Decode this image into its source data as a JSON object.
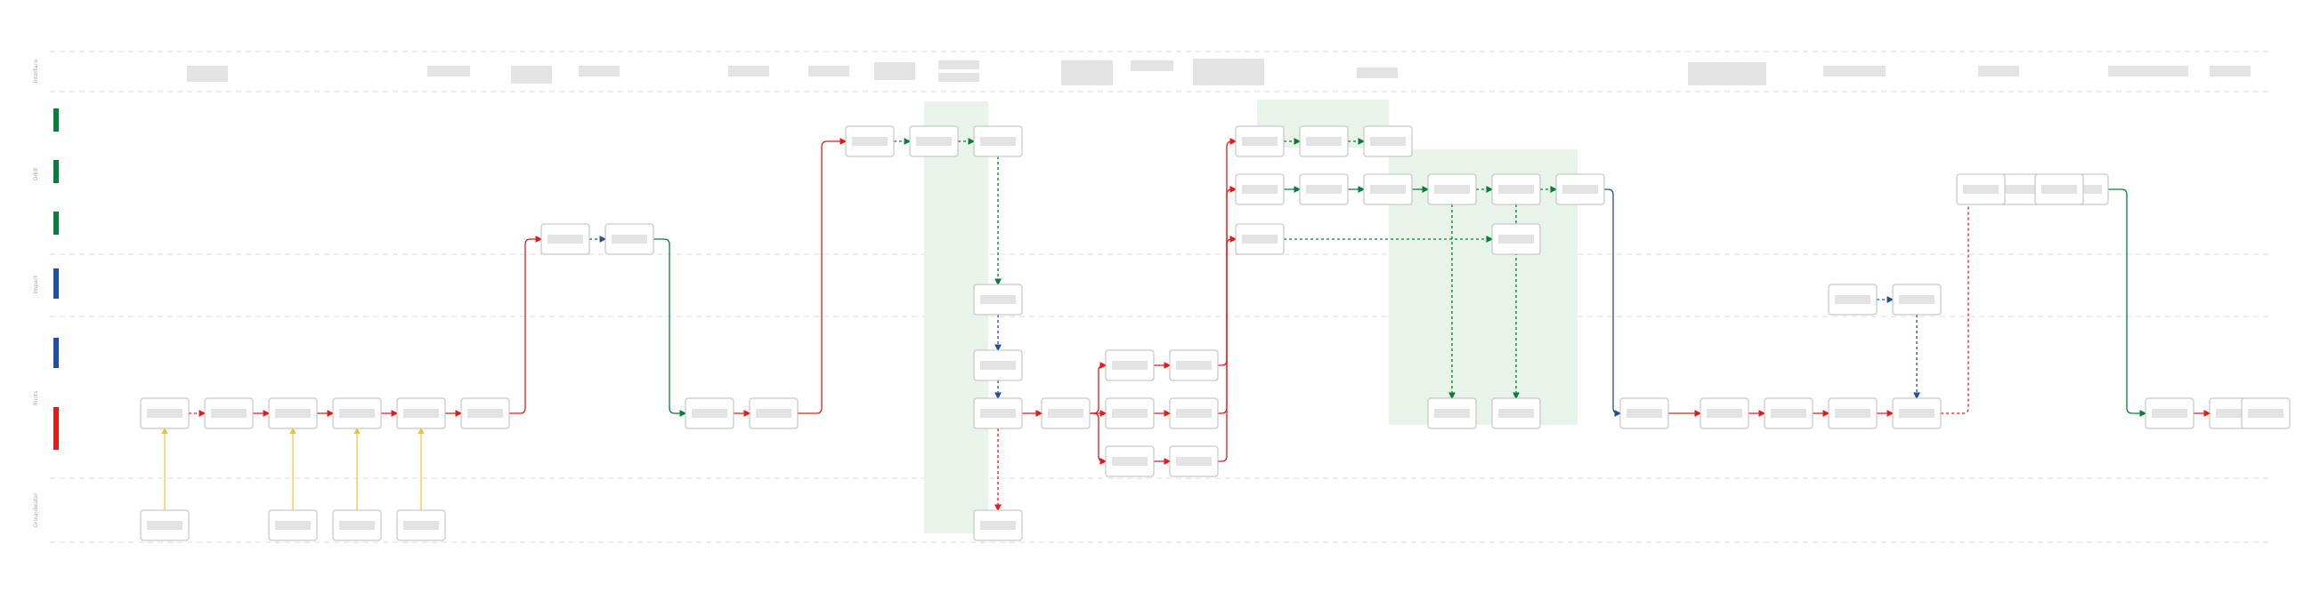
{
  "colors": {
    "green": "#0a7d3a",
    "blue": "#1f4fa3",
    "red": "#e21a1a",
    "yellow": "#f2c12e",
    "box_border": "#bdbdbd",
    "placeholder": "#e3e3e3",
    "group_fill": "#e8f3ea",
    "divider": "#dcdcdc"
  },
  "lanes": [
    {
      "id": "header",
      "label": "Interface"
    },
    {
      "id": "green",
      "label": "Orbit"
    },
    {
      "id": "blue",
      "label": "Impact"
    },
    {
      "id": "red",
      "label": "Roots"
    },
    {
      "id": "bottom",
      "label": "Groundwater"
    }
  ],
  "diagram": {
    "nodes": [
      "n1",
      "n2",
      "n3",
      "n4",
      "n5",
      "n6",
      "n7",
      "n8",
      "n9",
      "n10",
      "n11",
      "n12",
      "n13",
      "n14",
      "n15",
      "n16",
      "n17",
      "n18",
      "n19",
      "n20",
      "n21",
      "n22",
      "n23",
      "n24",
      "n25",
      "n26",
      "n27",
      "n28",
      "n29",
      "n30",
      "n31",
      "n32",
      "n33",
      "n34",
      "n35",
      "n36",
      "n37",
      "n38",
      "n39",
      "n40",
      "n41",
      "n42",
      "n43",
      "n44",
      "n45",
      "n46",
      "n47",
      "n48",
      "n49",
      "n50",
      "n51",
      "n52",
      "n53",
      "n54",
      "n55",
      "n56",
      "n57",
      "n58"
    ],
    "connectors": [
      {
        "from": "n1",
        "to": "n2",
        "color": "red",
        "style": "dashed"
      },
      {
        "from": "n2",
        "to": "n3",
        "color": "red",
        "style": "solid"
      },
      {
        "from": "n3",
        "to": "n4",
        "color": "red",
        "style": "solid"
      },
      {
        "from": "n4",
        "to": "n5",
        "color": "red",
        "style": "solid"
      },
      {
        "from": "n5",
        "to": "n6",
        "color": "red",
        "style": "solid"
      },
      {
        "from": "n6",
        "to": "n7",
        "color": "red",
        "style": "solid"
      },
      {
        "from": "n7",
        "to": "n8",
        "color": "blue",
        "style": "dashed"
      },
      {
        "from": "n8",
        "to": "n9",
        "color": "green",
        "style": "solid"
      },
      {
        "from": "n9",
        "to": "n10",
        "color": "red",
        "style": "solid"
      },
      {
        "from": "n10",
        "to": "n11",
        "color": "red",
        "style": "solid"
      },
      {
        "from": "n11",
        "to": "n12",
        "color": "green",
        "style": "dashed"
      },
      {
        "from": "n12",
        "to": "n13",
        "color": "green",
        "style": "dashed"
      },
      {
        "from": "n13",
        "to": "n14",
        "color": "green",
        "style": "dashed"
      },
      {
        "from": "n14",
        "to": "n15",
        "color": "blue",
        "style": "dashed"
      },
      {
        "from": "n15",
        "to": "n16",
        "color": "blue",
        "style": "dashed"
      },
      {
        "from": "n16",
        "to": "n17",
        "color": "red",
        "style": "dashed"
      },
      {
        "from": "n16",
        "to": "n18",
        "color": "red",
        "style": "solid"
      },
      {
        "from": "n18",
        "to": "n19",
        "color": "red",
        "style": "solid"
      },
      {
        "from": "n18",
        "to": "n20",
        "color": "red",
        "style": "solid"
      },
      {
        "from": "n18",
        "to": "n21",
        "color": "red",
        "style": "solid"
      },
      {
        "from": "n19",
        "to": "n22",
        "color": "red",
        "style": "solid"
      },
      {
        "from": "n20",
        "to": "n23",
        "color": "red",
        "style": "solid"
      },
      {
        "from": "n21",
        "to": "n24",
        "color": "red",
        "style": "solid"
      },
      {
        "from": "n22",
        "to": "n25",
        "color": "red",
        "style": "solid"
      },
      {
        "from": "n23",
        "to": "n28",
        "color": "red",
        "style": "solid"
      },
      {
        "from": "n24",
        "to": "n31",
        "color": "red",
        "style": "solid"
      },
      {
        "from": "n25",
        "to": "n26",
        "color": "green",
        "style": "dashed"
      },
      {
        "from": "n26",
        "to": "n27",
        "color": "green",
        "style": "dashed"
      },
      {
        "from": "n28",
        "to": "n29",
        "color": "green",
        "style": "solid"
      },
      {
        "from": "n29",
        "to": "n30",
        "color": "green",
        "style": "solid"
      },
      {
        "from": "n30",
        "to": "n32",
        "color": "green",
        "style": "solid"
      },
      {
        "from": "n32",
        "to": "n33",
        "color": "green",
        "style": "dashed"
      },
      {
        "from": "n33",
        "to": "n34",
        "color": "green",
        "style": "dashed"
      },
      {
        "from": "n31",
        "to": "n35",
        "color": "green",
        "style": "dashed"
      },
      {
        "from": "n32",
        "to": "n36",
        "color": "green",
        "style": "dashed"
      },
      {
        "from": "n33",
        "to": "n37",
        "color": "green",
        "style": "dashed"
      },
      {
        "from": "n34",
        "to": "n38",
        "color": "blue",
        "style": "solid"
      },
      {
        "from": "n38",
        "to": "n39",
        "color": "red",
        "style": "solid"
      },
      {
        "from": "n39",
        "to": "n40",
        "color": "red",
        "style": "solid"
      },
      {
        "from": "n40",
        "to": "n41",
        "color": "red",
        "style": "solid"
      },
      {
        "from": "n41",
        "to": "n42",
        "color": "red",
        "style": "solid"
      },
      {
        "from": "n43",
        "to": "n44",
        "color": "blue",
        "style": "dashed"
      },
      {
        "from": "n44",
        "to": "n42",
        "color": "blue",
        "style": "dashed"
      },
      {
        "from": "n42",
        "to": "n45",
        "color": "red",
        "style": "dashed"
      },
      {
        "from": "n45",
        "to": "n46",
        "color": "green",
        "style": "solid"
      },
      {
        "from": "n46",
        "to": "n47",
        "color": "green",
        "style": "solid"
      },
      {
        "from": "n47",
        "to": "n48",
        "color": "red",
        "style": "solid"
      }
    ]
  }
}
